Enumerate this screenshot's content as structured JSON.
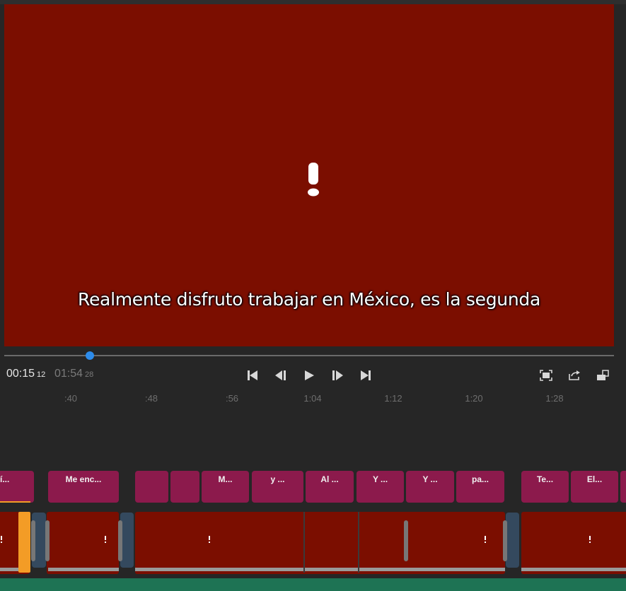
{
  "preview": {
    "subtitle": "Realmente disfruto trabajar en México, es la segunda",
    "background_color": "#7b0e00",
    "warning_icon": "exclamation-icon"
  },
  "playback": {
    "current_time": "00:15",
    "current_frames": "12",
    "total_time": "01:54",
    "total_frames": "28",
    "progress_fraction": 0.14,
    "accent_color": "#2d8ceb"
  },
  "controls": {
    "transport": [
      "skip-to-start-icon",
      "step-back-icon",
      "play-icon",
      "step-forward-icon",
      "skip-to-end-icon"
    ],
    "right": [
      "fit-to-screen-icon",
      "share-icon",
      "layout-icon"
    ]
  },
  "ruler": {
    "ticks": [
      ":40",
      ":48",
      ":56",
      "1:04",
      "1:12",
      "1:20",
      "1:28"
    ]
  },
  "captions": [
    {
      "label": "í..."
    },
    {
      "label": "Me enc..."
    },
    {
      "label": ""
    },
    {
      "label": ""
    },
    {
      "label": "M..."
    },
    {
      "label": "y ..."
    },
    {
      "label": "Al ..."
    },
    {
      "label": "Y ..."
    },
    {
      "label": "Y ..."
    },
    {
      "label": "pa..."
    },
    {
      "label": "Te..."
    },
    {
      "label": "El..."
    },
    {
      "label": ""
    }
  ],
  "caption_color": "#8c1a4c",
  "selection_color": "#f39c26",
  "transition_color": "#34495e",
  "track_color": "#1e7354"
}
